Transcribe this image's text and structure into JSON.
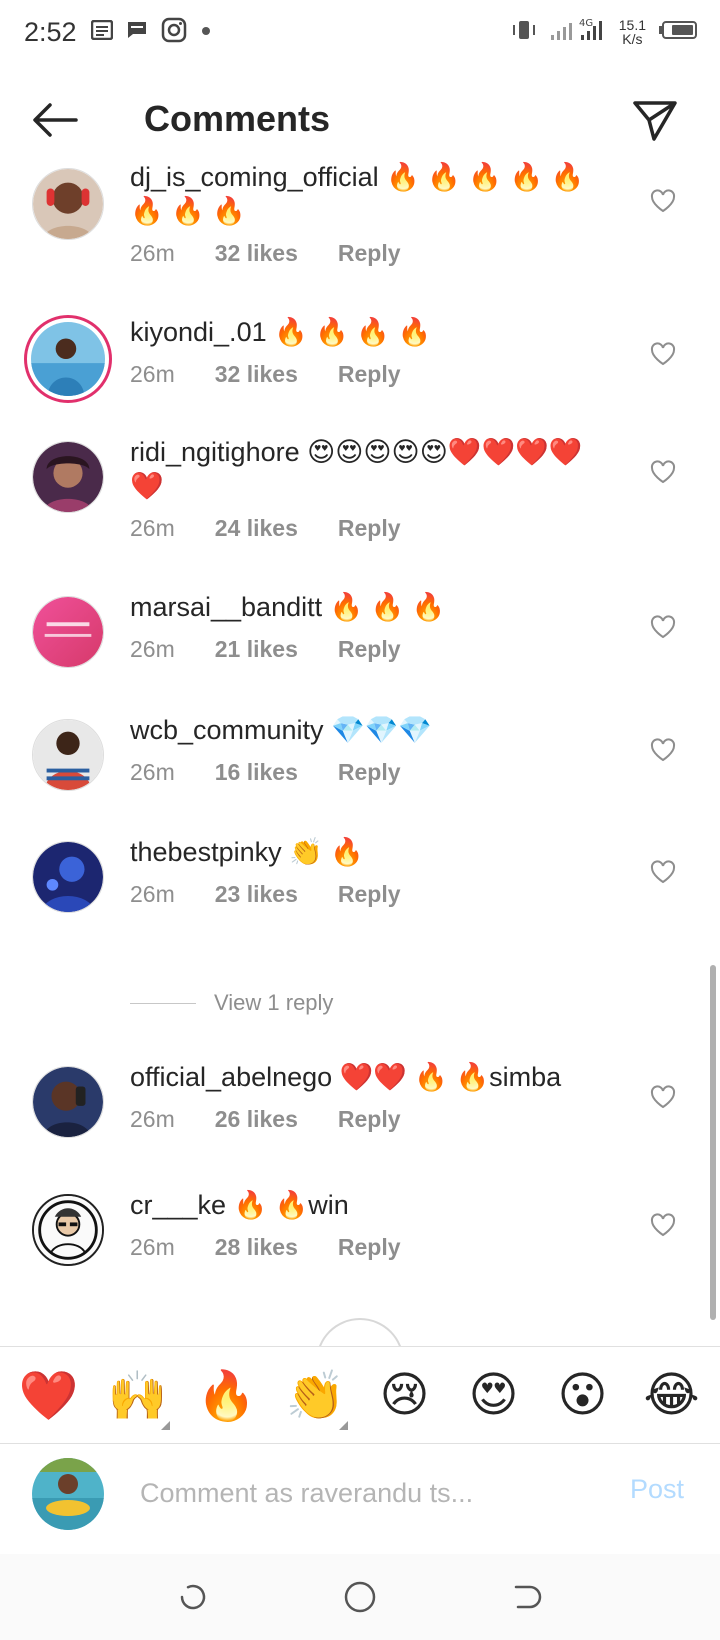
{
  "status_bar": {
    "time": "2:52",
    "net_speed_value": "15.1",
    "net_speed_unit": "K/s",
    "network_type": "4G",
    "icons": [
      "notes-icon",
      "message-icon",
      "instagram-icon",
      "dot-icon",
      "vibrate-icon",
      "signal-icon",
      "battery-icon"
    ]
  },
  "header": {
    "title": "Comments",
    "back_icon": "arrow-left-icon",
    "send_icon": "paper-plane-icon"
  },
  "comments": [
    {
      "username": "dj_is_coming_official",
      "text": " 🔥 🔥 🔥 🔥 🔥 🔥 🔥 🔥",
      "time": "26m",
      "likes": "32 likes",
      "reply": "Reply",
      "avatar_color": "#b9766a"
    },
    {
      "username": "kiyondi_.01",
      "text": " 🔥 🔥 🔥 🔥",
      "time": "26m",
      "likes": "32 likes",
      "reply": "Reply",
      "avatar_color": "#3d9ad1"
    },
    {
      "username": "ridi_ngitighore",
      "text": " 😍😍😍😍😍❤️❤️❤️❤️❤️",
      "time": "26m",
      "likes": "24 likes",
      "reply": "Reply",
      "avatar_color": "#7a4a6a"
    },
    {
      "username": "marsai__banditt",
      "text": " 🔥 🔥 🔥",
      "time": "26m",
      "likes": "21 likes",
      "reply": "Reply",
      "avatar_color": "#e1457a"
    },
    {
      "username": "wcb_community",
      "text": " 💎💎💎",
      "time": "26m",
      "likes": "16 likes",
      "reply": "Reply",
      "avatar_color": "#d84a3a"
    },
    {
      "username": "thebestpinky",
      "text": " 👏 🔥",
      "time": "26m",
      "likes": "23 likes",
      "reply": "Reply",
      "avatar_color": "#2b3f9a"
    },
    {
      "username": "official_abelnego",
      "text": " ❤️❤️ 🔥 🔥simba",
      "time": "26m",
      "likes": "26 likes",
      "reply": "Reply",
      "avatar_color": "#33406e"
    },
    {
      "username": "cr___ke",
      "text": " 🔥 🔥win",
      "time": "26m",
      "likes": "28 likes",
      "reply": "Reply",
      "avatar_color": "#f2f2f2"
    }
  ],
  "view_replies": "View 1 reply",
  "emoji_bar": [
    "❤️",
    "🙌",
    "🔥",
    "👏",
    "😢",
    "😍",
    "😮",
    "😂"
  ],
  "comment_input": {
    "placeholder": "Comment as raverandu ts...",
    "post_label": "Post"
  },
  "nav_bar": {
    "icons": [
      "recent-apps-icon",
      "home-icon",
      "back-icon"
    ]
  },
  "colors": {
    "text": "#262626",
    "meta": "#8e8e8e",
    "post_disabled": "#b3dbff",
    "story_ring": "#e1306c"
  }
}
